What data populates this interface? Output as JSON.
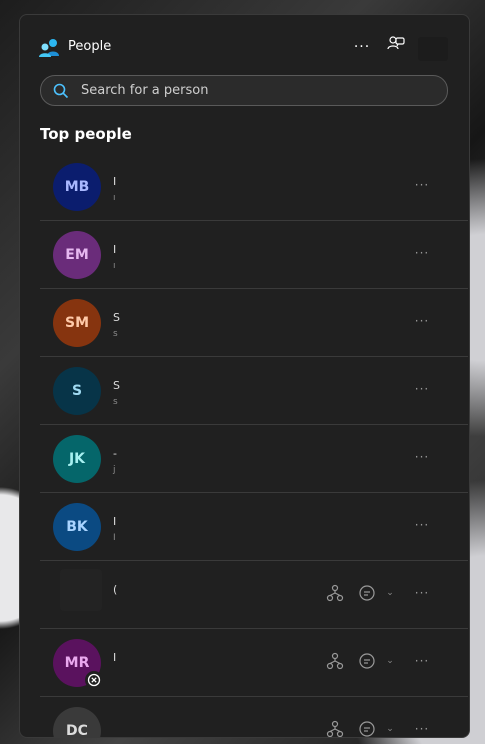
{
  "app": {
    "title": "People"
  },
  "header": {
    "more_label": "···"
  },
  "search": {
    "placeholder": "Search for a person",
    "value": ""
  },
  "section": {
    "title": "Top people"
  },
  "people": [
    {
      "initials": "MB",
      "avatar_bg": "#0b1d6e",
      "avatar_fg": "#a9b8ff",
      "name_fragment": "I",
      "sub_fragment": "ı"
    },
    {
      "initials": "EM",
      "avatar_bg": "#6a2c7a",
      "avatar_fg": "#e6b8f0",
      "name_fragment": "I",
      "sub_fragment": "ı"
    },
    {
      "initials": "SM",
      "avatar_bg": "#86340f",
      "avatar_fg": "#ffc9a8",
      "name_fragment": "S",
      "sub_fragment": "s"
    },
    {
      "initials": "S",
      "avatar_bg": "#073448",
      "avatar_fg": "#9fd9f0",
      "name_fragment": "S",
      "sub_fragment": "s"
    },
    {
      "initials": "JK",
      "avatar_bg": "#05666a",
      "avatar_fg": "#a7f0f0",
      "name_fragment": "-",
      "sub_fragment": "j"
    },
    {
      "initials": "BK",
      "avatar_bg": "#0b4a82",
      "avatar_fg": "#a9d4ff",
      "name_fragment": "I",
      "sub_fragment": "I"
    },
    {
      "initials": "",
      "avatar_bg": "",
      "avatar_fg": "",
      "name_fragment": "(",
      "sub_fragment": ""
    },
    {
      "initials": "MR",
      "avatar_bg": "#5a125e",
      "avatar_fg": "#e9a8ee",
      "name_fragment": "I",
      "sub_fragment": "",
      "presence": "blocked"
    },
    {
      "initials": "DC",
      "avatar_bg": "#3a3a3a",
      "avatar_fg": "#dcdcdc",
      "name_fragment": "",
      "sub_fragment": ""
    }
  ],
  "icons": {
    "app": "people-app-icon",
    "more": "more-icon",
    "chat": "chat-icon",
    "search": "search-icon",
    "org": "org-chart-icon",
    "dropdown": "chevron-down-icon",
    "presence_blocked": "blocked-icon"
  },
  "colors": {
    "accent": "#4cc2ff",
    "panel": "#202020",
    "divider": "#3a3a3a"
  }
}
